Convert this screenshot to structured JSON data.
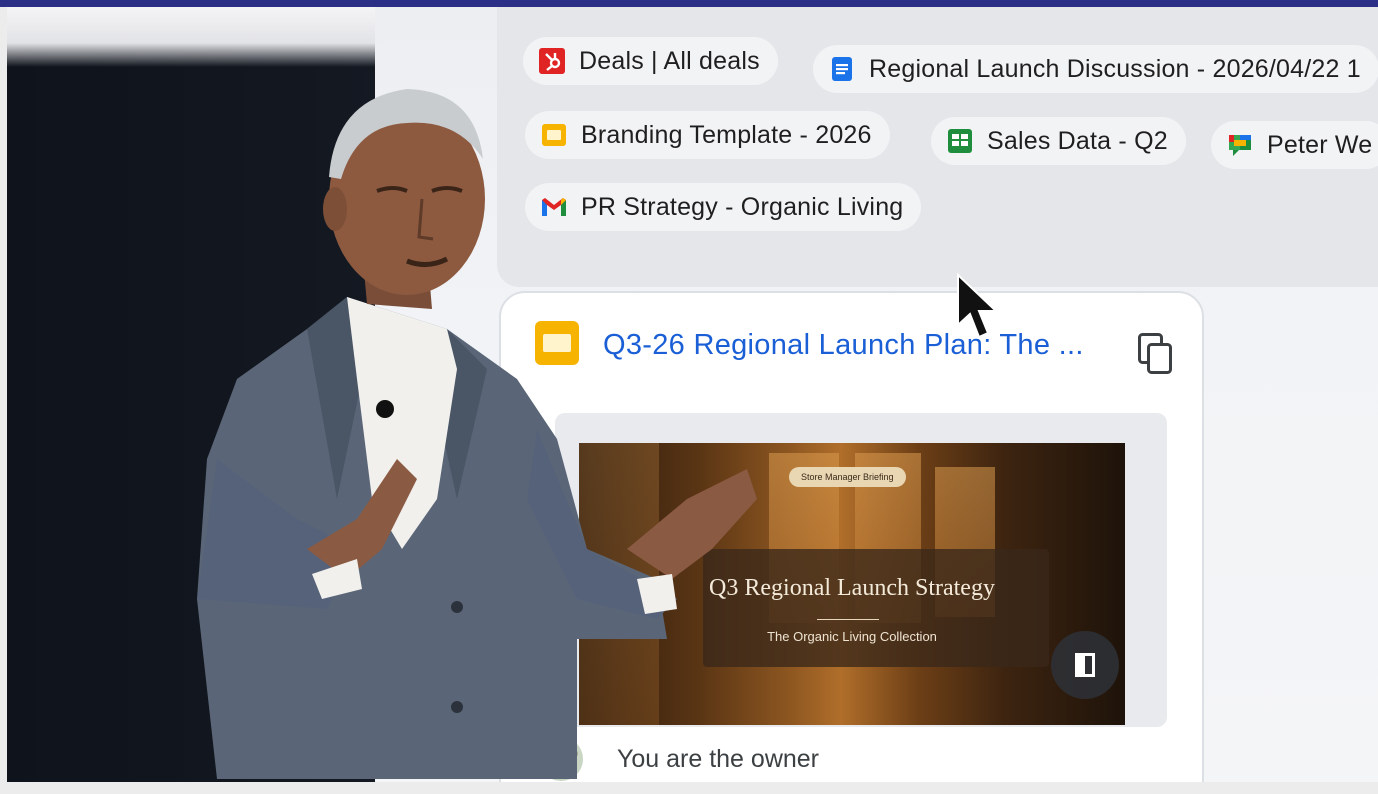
{
  "colors": {
    "link_blue": "#1a5fd6",
    "slides_yellow": "#f6b400",
    "docs_blue": "#1a73e8",
    "sheets_green": "#1e8e3e",
    "hubspot_red": "#e02424",
    "top_bar": "#2b2f86"
  },
  "chips": [
    {
      "label": "Deals | All deals",
      "icon": "hubspot-icon"
    },
    {
      "label": "Regional Launch Discussion - 2026/04/22 1",
      "icon": "google-docs-icon"
    },
    {
      "label": "Branding Template - 2026",
      "icon": "google-slides-icon"
    },
    {
      "label": "Sales Data - Q2",
      "icon": "google-sheets-icon"
    },
    {
      "label": "Peter We",
      "icon": "google-chat-icon"
    },
    {
      "label": "PR Strategy - Organic Living",
      "icon": "gmail-icon"
    }
  ],
  "card": {
    "title": "Q3-26 Regional Launch Plan: The ...",
    "icon": "google-slides-icon",
    "copy_icon": "copy-icon",
    "thumbnail": {
      "badge": "Store Manager Briefing",
      "title": "Q3 Regional Launch Strategy",
      "subtitle": "The Organic Living Collection"
    },
    "open_icon": "open-in-slides-icon",
    "owner_text": "You are the owner"
  }
}
